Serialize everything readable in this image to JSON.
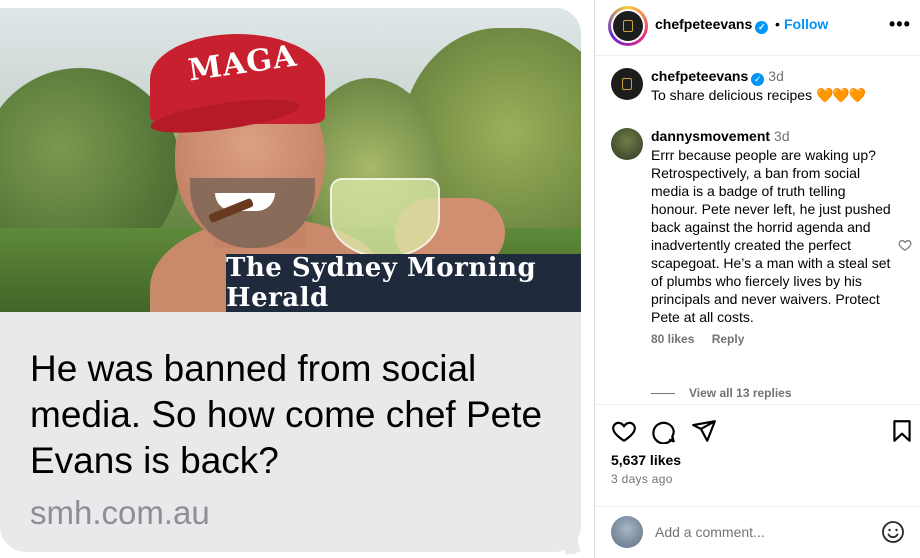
{
  "preview": {
    "cap_text": "MAGA",
    "masthead": "The Sydney Morning Herald",
    "headline": "He was banned from social media. So how come chef Pete Evans is back?",
    "domain": "smh.com.au"
  },
  "post": {
    "header": {
      "username": "chefpeteevans",
      "verified_mark": "✓",
      "separator": "•",
      "follow_label": "Follow",
      "more_label": "•••"
    },
    "caption": {
      "username": "chefpeteevans",
      "time": "3d",
      "text": "To share delicious recipes",
      "emojis": "🧡🧡🧡"
    },
    "comment": {
      "username": "dannysmovement",
      "time": "3d",
      "text": "Errr because people are waking up? Retrospectively, a ban from social media is a badge of truth telling honour. Pete never left, he just pushed back against the horrid agenda and inadvertently created the perfect scapegoat. He’s a man with a steal set of plumbs who fiercely lives by his principals and never waivers. Protect Pete at all costs.",
      "likes": "80 likes",
      "reply_label": "Reply"
    },
    "view_replies": "View all 13 replies",
    "likes": "5,637 likes",
    "date": "3 days ago",
    "add_comment_placeholder": "Add a comment...",
    "icons": [
      "heart-icon",
      "comment-icon",
      "share-icon",
      "bookmark-icon",
      "emoji-icon"
    ],
    "colors": {
      "link_blue": "#0095f6",
      "secondary_text": "#737373",
      "masthead_bg": "#1f2a3c",
      "bubble_bg": "#e9e9eb"
    }
  }
}
